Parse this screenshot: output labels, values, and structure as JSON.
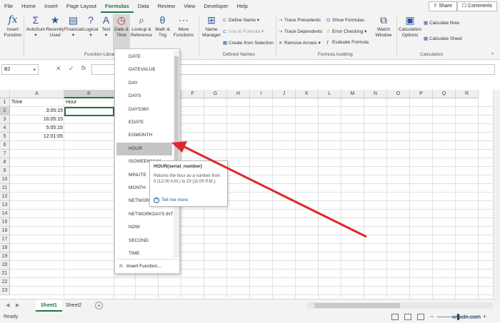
{
  "menubar": {
    "tabs": [
      "File",
      "Home",
      "Insert",
      "Page Layout",
      "Formulas",
      "Data",
      "Review",
      "View",
      "Developer",
      "Help"
    ],
    "share": "Share",
    "comments": "Comments"
  },
  "ribbon": {
    "insert_function": [
      "Insert",
      "Function"
    ],
    "autosum": "AutoSum",
    "recently_used": [
      "Recently",
      "Used"
    ],
    "financial": "Financial",
    "logical": "Logical",
    "text": "Text",
    "date_time": [
      "Date &",
      "Time"
    ],
    "lookup_ref": [
      "Lookup &",
      "Reference"
    ],
    "math_trig": [
      "Math &",
      "Trig"
    ],
    "more_functions": [
      "More",
      "Functions"
    ],
    "group_function_library": "Function Library",
    "name_manager": [
      "Name",
      "Manager"
    ],
    "define_name": "Define Name",
    "use_in_formula": "Use in Formula",
    "create_from_selection": "Create from Selection",
    "group_defined_names": "Defined Names",
    "trace_precedents": "Trace Precedents",
    "trace_dependents": "Trace Dependents",
    "remove_arrows": "Remove Arrows",
    "show_formulas": "Show Formulas",
    "error_checking": "Error Checking",
    "evaluate_formula": "Evaluate Formula",
    "watch_window": [
      "Watch",
      "Window"
    ],
    "group_formula_auditing": "Formula Auditing",
    "calc_options": [
      "Calculation",
      "Options"
    ],
    "calc_now": "Calculate Now",
    "calc_sheet": "Calculate Sheet",
    "group_calculation": "Calculation"
  },
  "formula_bar": {
    "name_box": "B2",
    "fx": "fx"
  },
  "grid": {
    "columns": [
      "A",
      "B",
      "C",
      "D",
      "E",
      "F",
      "G",
      "H",
      "I",
      "J",
      "K",
      "L",
      "M",
      "N",
      "O",
      "P",
      "Q",
      "R"
    ],
    "rows": [
      "1",
      "2",
      "3",
      "4",
      "5",
      "6",
      "7",
      "8",
      "9",
      "10",
      "11",
      "12",
      "13",
      "14",
      "15",
      "16",
      "17",
      "18",
      "19",
      "20",
      "21",
      "22",
      "23"
    ],
    "a1": "Time",
    "b1": "Hour",
    "a2": "3:05:15",
    "a3": "16:05:15",
    "a4": "5:05:15",
    "a5": "12:01:05"
  },
  "date_time_menu": {
    "items": [
      "DATE",
      "DATEVALUE",
      "DAY",
      "DAYS",
      "DAYS360",
      "EDATE",
      "EOMONTH",
      "HOUR",
      "ISOWEEKNUM",
      "MINUTE",
      "MONTH",
      "NETWORKDAYS",
      "NETWORKDAYS.INTL",
      "NOW",
      "SECOND",
      "TIME"
    ],
    "insert_function": "Insert Function..."
  },
  "tooltip": {
    "title": "HOUR(serial_number)",
    "description": "Returns the hour as a number from 0 (12:00 A.M.) to 23 (11:00 P.M.).",
    "link": "Tell me more"
  },
  "sheets": {
    "tabs": [
      "Sheet1",
      "Sheet2"
    ],
    "active": "Sheet1"
  },
  "status": {
    "text": "Ready"
  },
  "watermark": "wsxdn.com",
  "colors": {
    "accent": "#217346",
    "arrow": "#e0262b"
  }
}
